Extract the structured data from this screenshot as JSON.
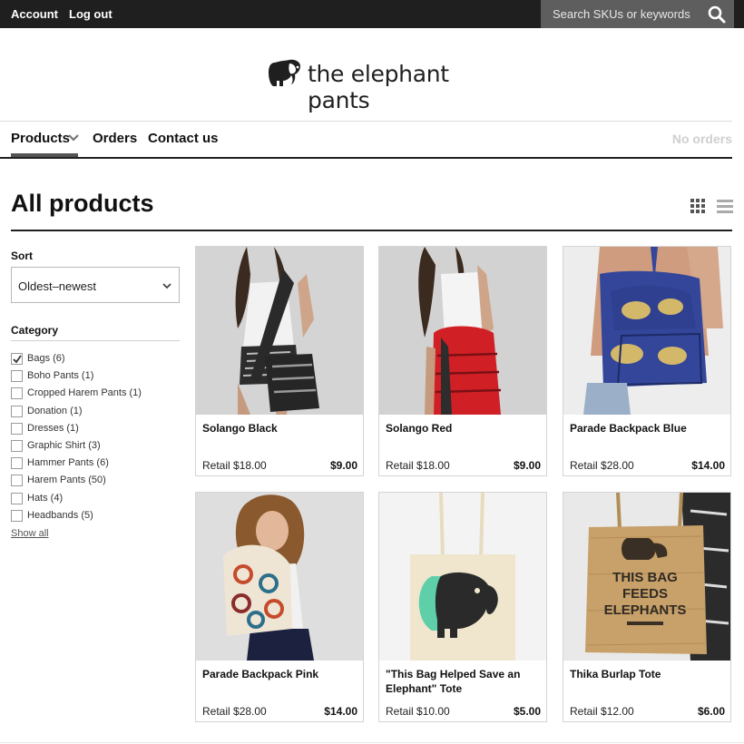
{
  "topbar": {
    "account_label": "Account",
    "logout_label": "Log out",
    "search_placeholder": "Search SKUs or keywords",
    "search_icon": "search-icon"
  },
  "brand": {
    "name": "the elephant pants",
    "logo_icon": "elephant-logo-icon"
  },
  "nav": {
    "items": [
      {
        "label": "Products",
        "active": true,
        "has_dropdown": true
      },
      {
        "label": "Orders"
      },
      {
        "label": "Contact us"
      }
    ],
    "orders_status": "No orders"
  },
  "page": {
    "title": "All products",
    "view_icons": [
      "grid-view-icon",
      "list-view-icon"
    ]
  },
  "sidebar": {
    "sort_label": "Sort",
    "sort_value": "Oldest–newest",
    "category_label": "Category",
    "categories": [
      {
        "label": "Bags (6)",
        "checked": true
      },
      {
        "label": "Boho Pants (1)",
        "checked": false
      },
      {
        "label": "Cropped Harem Pants (1)",
        "checked": false
      },
      {
        "label": "Donation (1)",
        "checked": false
      },
      {
        "label": "Dresses (1)",
        "checked": false
      },
      {
        "label": "Graphic Shirt (3)",
        "checked": false
      },
      {
        "label": "Hammer Pants (6)",
        "checked": false
      },
      {
        "label": "Harem Pants (50)",
        "checked": false
      },
      {
        "label": "Hats (4)",
        "checked": false
      },
      {
        "label": "Headbands (5)",
        "checked": false
      }
    ],
    "show_all_label": "Show all"
  },
  "products": [
    {
      "title": "Solango Black",
      "retail": "Retail $18.00",
      "price": "$9.00"
    },
    {
      "title": "Solango Red",
      "retail": "Retail $18.00",
      "price": "$9.00"
    },
    {
      "title": "Parade Backpack Blue",
      "retail": "Retail $28.00",
      "price": "$14.00"
    },
    {
      "title": "Parade Backpack Pink",
      "retail": "Retail $28.00",
      "price": "$14.00"
    },
    {
      "title": "\"This Bag Helped Save an Elephant\" Tote",
      "retail": "Retail $10.00",
      "price": "$5.00"
    },
    {
      "title": "Thika Burlap Tote",
      "retail": "Retail $12.00",
      "price": "$6.00"
    }
  ],
  "tote_print": [
    "THIS BAG",
    "FEEDS",
    "ELEPHANTS"
  ]
}
